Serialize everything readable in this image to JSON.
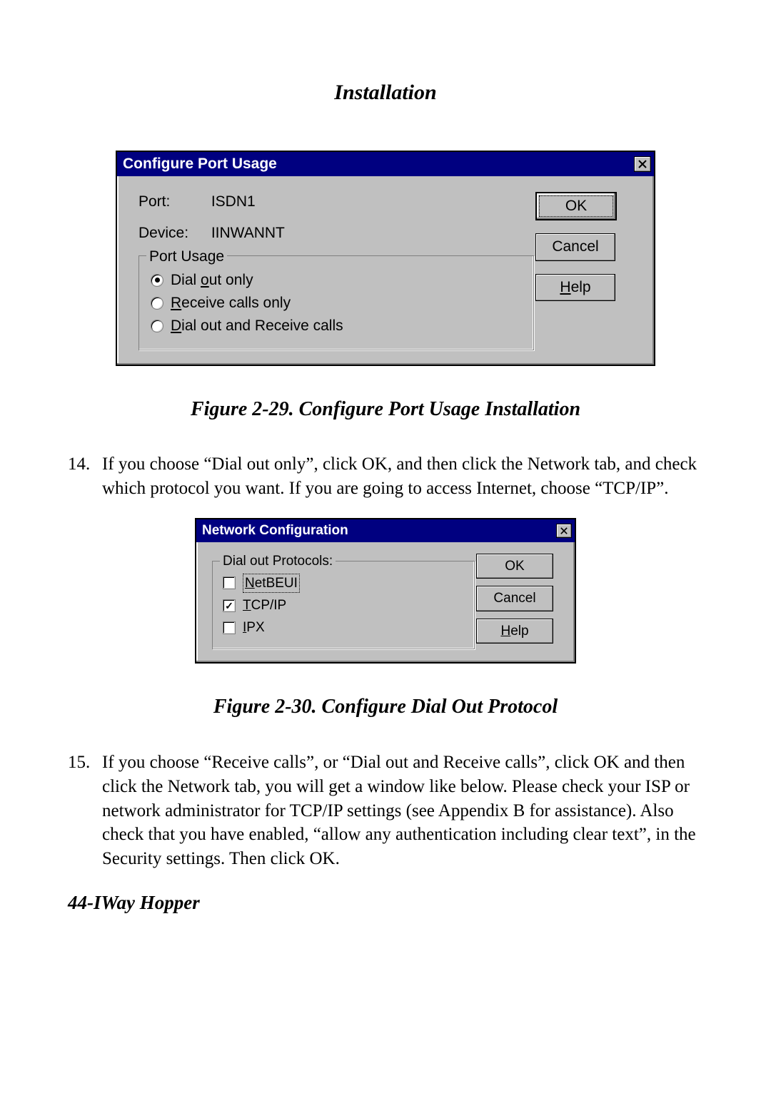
{
  "header": {
    "section_title": "Installation"
  },
  "figure29": {
    "caption": "Figure 2-29. Configure Port Usage Installation"
  },
  "figure30": {
    "caption": "Figure 2-30. Configure Dial Out Protocol"
  },
  "step14": {
    "number": "14.",
    "text": "If you choose “Dial out only”, click OK, and then click the Network tab, and check which protocol you want.  If you are going to access Internet, choose “TCP/IP”."
  },
  "step15": {
    "number": "15.",
    "text": "If you choose “Receive calls”, or “Dial out and Receive calls”, click OK and then click the Network tab, you will get a window like below.  Please check your ISP or network administrator for TCP/IP settings (see Appendix B for assistance).  Also check that you have enabled, “allow any authentication including clear text”, in the Security settings.  Then click OK."
  },
  "footer": {
    "text": "44-IWay Hopper"
  },
  "dialog_port": {
    "title": "Configure Port Usage",
    "port_label": "Port:",
    "port_value": "ISDN1",
    "device_label": "Device:",
    "device_value": "IINWANNT",
    "group_legend": "Port Usage",
    "radios": {
      "dial_out": "Dial out only",
      "receive": "Receive calls only",
      "both": "Dial out and Receive calls"
    },
    "buttons": {
      "ok": "OK",
      "cancel": "Cancel",
      "help": "Help"
    }
  },
  "dialog_net": {
    "title": "Network Configuration",
    "group_legend": "Dial out Protocols:",
    "checks": {
      "netbeui": "NetBEUI",
      "tcpip": "TCP/IP",
      "ipx": "IPX"
    },
    "buttons": {
      "ok": "OK",
      "cancel": "Cancel",
      "help": "Help"
    }
  }
}
